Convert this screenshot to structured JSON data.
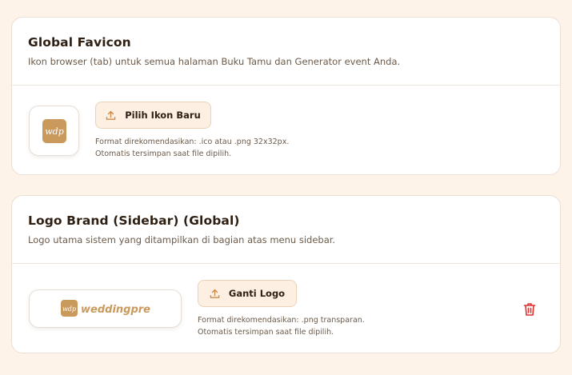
{
  "colors": {
    "page_bg": "#fdf3e9",
    "brand_gold": "#c99a5c",
    "button_bg": "#fdf0e3",
    "delete_red": "#e03131"
  },
  "favicon": {
    "title": "Global Favicon",
    "subtitle": "Ikon browser (tab) untuk semua halaman Buku Tamu dan Generator event Anda.",
    "preview_text": "wdp",
    "button_label": "Pilih Ikon Baru",
    "button_icon": "upload-icon",
    "hint_line1": "Format direkomendasikan: .ico atau .png 32x32px.",
    "hint_line2": "Otomatis tersimpan saat file dipilih."
  },
  "logo": {
    "title": "Logo Brand (Sidebar) (Global)",
    "subtitle": "Logo utama sistem yang ditampilkan di bagian atas menu sidebar.",
    "preview_mark": "wdp",
    "preview_wordmark": "weddingpress",
    "button_label": "Ganti Logo",
    "button_icon": "upload-icon",
    "hint_line1": "Format direkomendasikan: .png transparan.",
    "hint_line2": "Otomatis tersimpan saat file dipilih.",
    "delete_icon": "trash-icon"
  }
}
